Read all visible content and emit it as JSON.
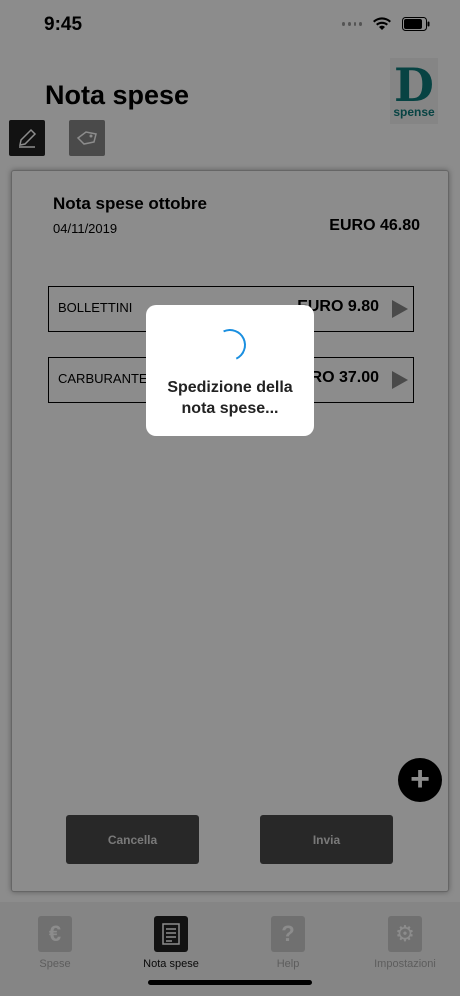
{
  "status_bar": {
    "time": "9:45"
  },
  "header": {
    "title": "Nota spese",
    "logo_letter": "D",
    "logo_text": "spense"
  },
  "toolbar": {
    "edit_icon": "pencil-icon",
    "tag_icon": "tag-icon"
  },
  "expense_note": {
    "title": "Nota spese ottobre",
    "date": "04/11/2019",
    "total": "EURO 46.80",
    "items": [
      {
        "category": "BOLLETTINI",
        "amount": "EURO 9.80"
      },
      {
        "category": "CARBURANTE",
        "amount": "EURO 37.00"
      }
    ],
    "cancel_label": "Cancella",
    "send_label": "Invia"
  },
  "loading_dialog": {
    "line1": "Spedizione della",
    "line2": "nota spese..."
  },
  "tab_bar": {
    "tabs": [
      {
        "label": "Spese",
        "icon": "euro-icon"
      },
      {
        "label": "Nota spese",
        "icon": "document-icon",
        "active": true
      },
      {
        "label": "Help",
        "icon": "question-icon"
      },
      {
        "label": "Impostazioni",
        "icon": "gear-icon"
      }
    ]
  },
  "colors": {
    "accent": "#1a8fe0",
    "brand": "#0e7b7b"
  }
}
